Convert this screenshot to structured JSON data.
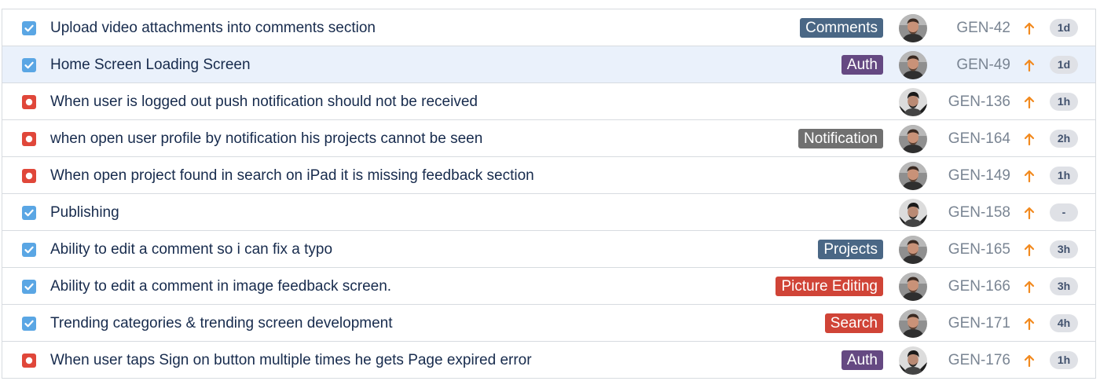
{
  "colors": {
    "label_slate": "#4a6785",
    "label_purple": "#654982",
    "label_gray": "#707070",
    "label_red": "#d04437",
    "story_icon": "#5aa6e4",
    "bug_icon": "#e0473a",
    "priority_high": "#f28a1f",
    "selected_row_bg": "#eaf1fb"
  },
  "issues": [
    {
      "type": "story",
      "type_icon": "checkbox-story-icon",
      "summary": "Upload video attachments into comments section",
      "label": "Comments",
      "label_color": "#4a6785",
      "avatar": "avatar-a",
      "key": "GEN-42",
      "priority": "high",
      "priority_icon": "arrow-up-icon",
      "estimate": "1d",
      "selected": false
    },
    {
      "type": "story",
      "type_icon": "checkbox-story-icon",
      "summary": "Home Screen Loading Screen",
      "label": "Auth",
      "label_color": "#654982",
      "avatar": "avatar-a",
      "key": "GEN-49",
      "priority": "high",
      "priority_icon": "arrow-up-icon",
      "estimate": "1d",
      "selected": true
    },
    {
      "type": "bug",
      "type_icon": "bug-icon",
      "summary": "When user is logged out push notification should not be received",
      "label": "",
      "label_color": "",
      "avatar": "avatar-b",
      "key": "GEN-136",
      "priority": "high",
      "priority_icon": "arrow-up-icon",
      "estimate": "1h",
      "selected": false
    },
    {
      "type": "bug",
      "type_icon": "bug-icon",
      "summary": "when open user profile by notification his projects cannot be seen",
      "label": "Notification",
      "label_color": "#707070",
      "avatar": "avatar-a",
      "key": "GEN-164",
      "priority": "high",
      "priority_icon": "arrow-up-icon",
      "estimate": "2h",
      "selected": false
    },
    {
      "type": "bug",
      "type_icon": "bug-icon",
      "summary": "When open project found in search on iPad it is missing feedback section",
      "label": "",
      "label_color": "",
      "avatar": "avatar-a",
      "key": "GEN-149",
      "priority": "high",
      "priority_icon": "arrow-up-icon",
      "estimate": "1h",
      "selected": false
    },
    {
      "type": "story",
      "type_icon": "checkbox-story-icon",
      "summary": "Publishing",
      "label": "",
      "label_color": "",
      "avatar": "avatar-b",
      "key": "GEN-158",
      "priority": "high",
      "priority_icon": "arrow-up-icon",
      "estimate": "-",
      "selected": false
    },
    {
      "type": "story",
      "type_icon": "checkbox-story-icon",
      "summary": "Ability to edit a comment so i can fix a typo",
      "label": "Projects",
      "label_color": "#4a6785",
      "avatar": "avatar-a",
      "key": "GEN-165",
      "priority": "high",
      "priority_icon": "arrow-up-icon",
      "estimate": "3h",
      "selected": false
    },
    {
      "type": "story",
      "type_icon": "checkbox-story-icon",
      "summary": "Ability to edit a comment in image feedback screen.",
      "label": "Picture Editing",
      "label_color": "#d04437",
      "avatar": "avatar-a",
      "key": "GEN-166",
      "priority": "high",
      "priority_icon": "arrow-up-icon",
      "estimate": "3h",
      "selected": false
    },
    {
      "type": "story",
      "type_icon": "checkbox-story-icon",
      "summary": "Trending categories & trending screen development",
      "label": "Search",
      "label_color": "#d04437",
      "avatar": "avatar-a",
      "key": "GEN-171",
      "priority": "high",
      "priority_icon": "arrow-up-icon",
      "estimate": "4h",
      "selected": false
    },
    {
      "type": "bug",
      "type_icon": "bug-icon",
      "summary": "When user taps Sign on button multiple times he gets Page expired error",
      "label": "Auth",
      "label_color": "#654982",
      "avatar": "avatar-b",
      "key": "GEN-176",
      "priority": "high",
      "priority_icon": "arrow-up-icon",
      "estimate": "1h",
      "selected": false
    }
  ]
}
